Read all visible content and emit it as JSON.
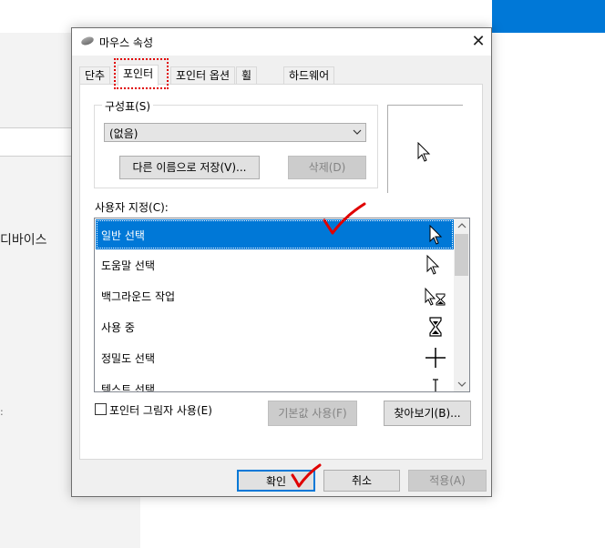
{
  "background": {
    "sidebar_text": "디바이스",
    "dot_text": ":"
  },
  "dialog": {
    "title": "마우스 속성",
    "close_symbol": "✕"
  },
  "tabs": [
    {
      "label": "단추"
    },
    {
      "label": "포인터"
    },
    {
      "label": "포인터 옵션"
    },
    {
      "label": "휠"
    },
    {
      "label": "하드웨어"
    }
  ],
  "scheme": {
    "label": "구성표(S)",
    "selected": "(없음)",
    "save_as_label": "다른 이름으로 저장(V)...",
    "delete_label": "삭제(D)"
  },
  "customize": {
    "label": "사용자 지정(C):",
    "items": [
      {
        "label": "일반 선택",
        "icon": "arrow-cursor-icon"
      },
      {
        "label": "도움말 선택",
        "icon": "help-cursor-icon"
      },
      {
        "label": "백그라운드 작업",
        "icon": "working-cursor-icon"
      },
      {
        "label": "사용 중",
        "icon": "busy-hourglass-icon"
      },
      {
        "label": "정밀도 선택",
        "icon": "crosshair-cursor-icon"
      },
      {
        "label": "텍스트 선택",
        "icon": "text-beam-cursor-icon"
      }
    ],
    "selected_index": 0
  },
  "options": {
    "shadow_label": "포인터 그림자 사용(E)",
    "shadow_checked": false,
    "default_label": "기본값 사용(F)",
    "browse_label": "찾아보기(B)..."
  },
  "footer": {
    "ok_label": "확인",
    "cancel_label": "취소",
    "apply_label": "적용(A)"
  },
  "colors": {
    "selection": "#0078d7",
    "annotation": "#e00000"
  }
}
